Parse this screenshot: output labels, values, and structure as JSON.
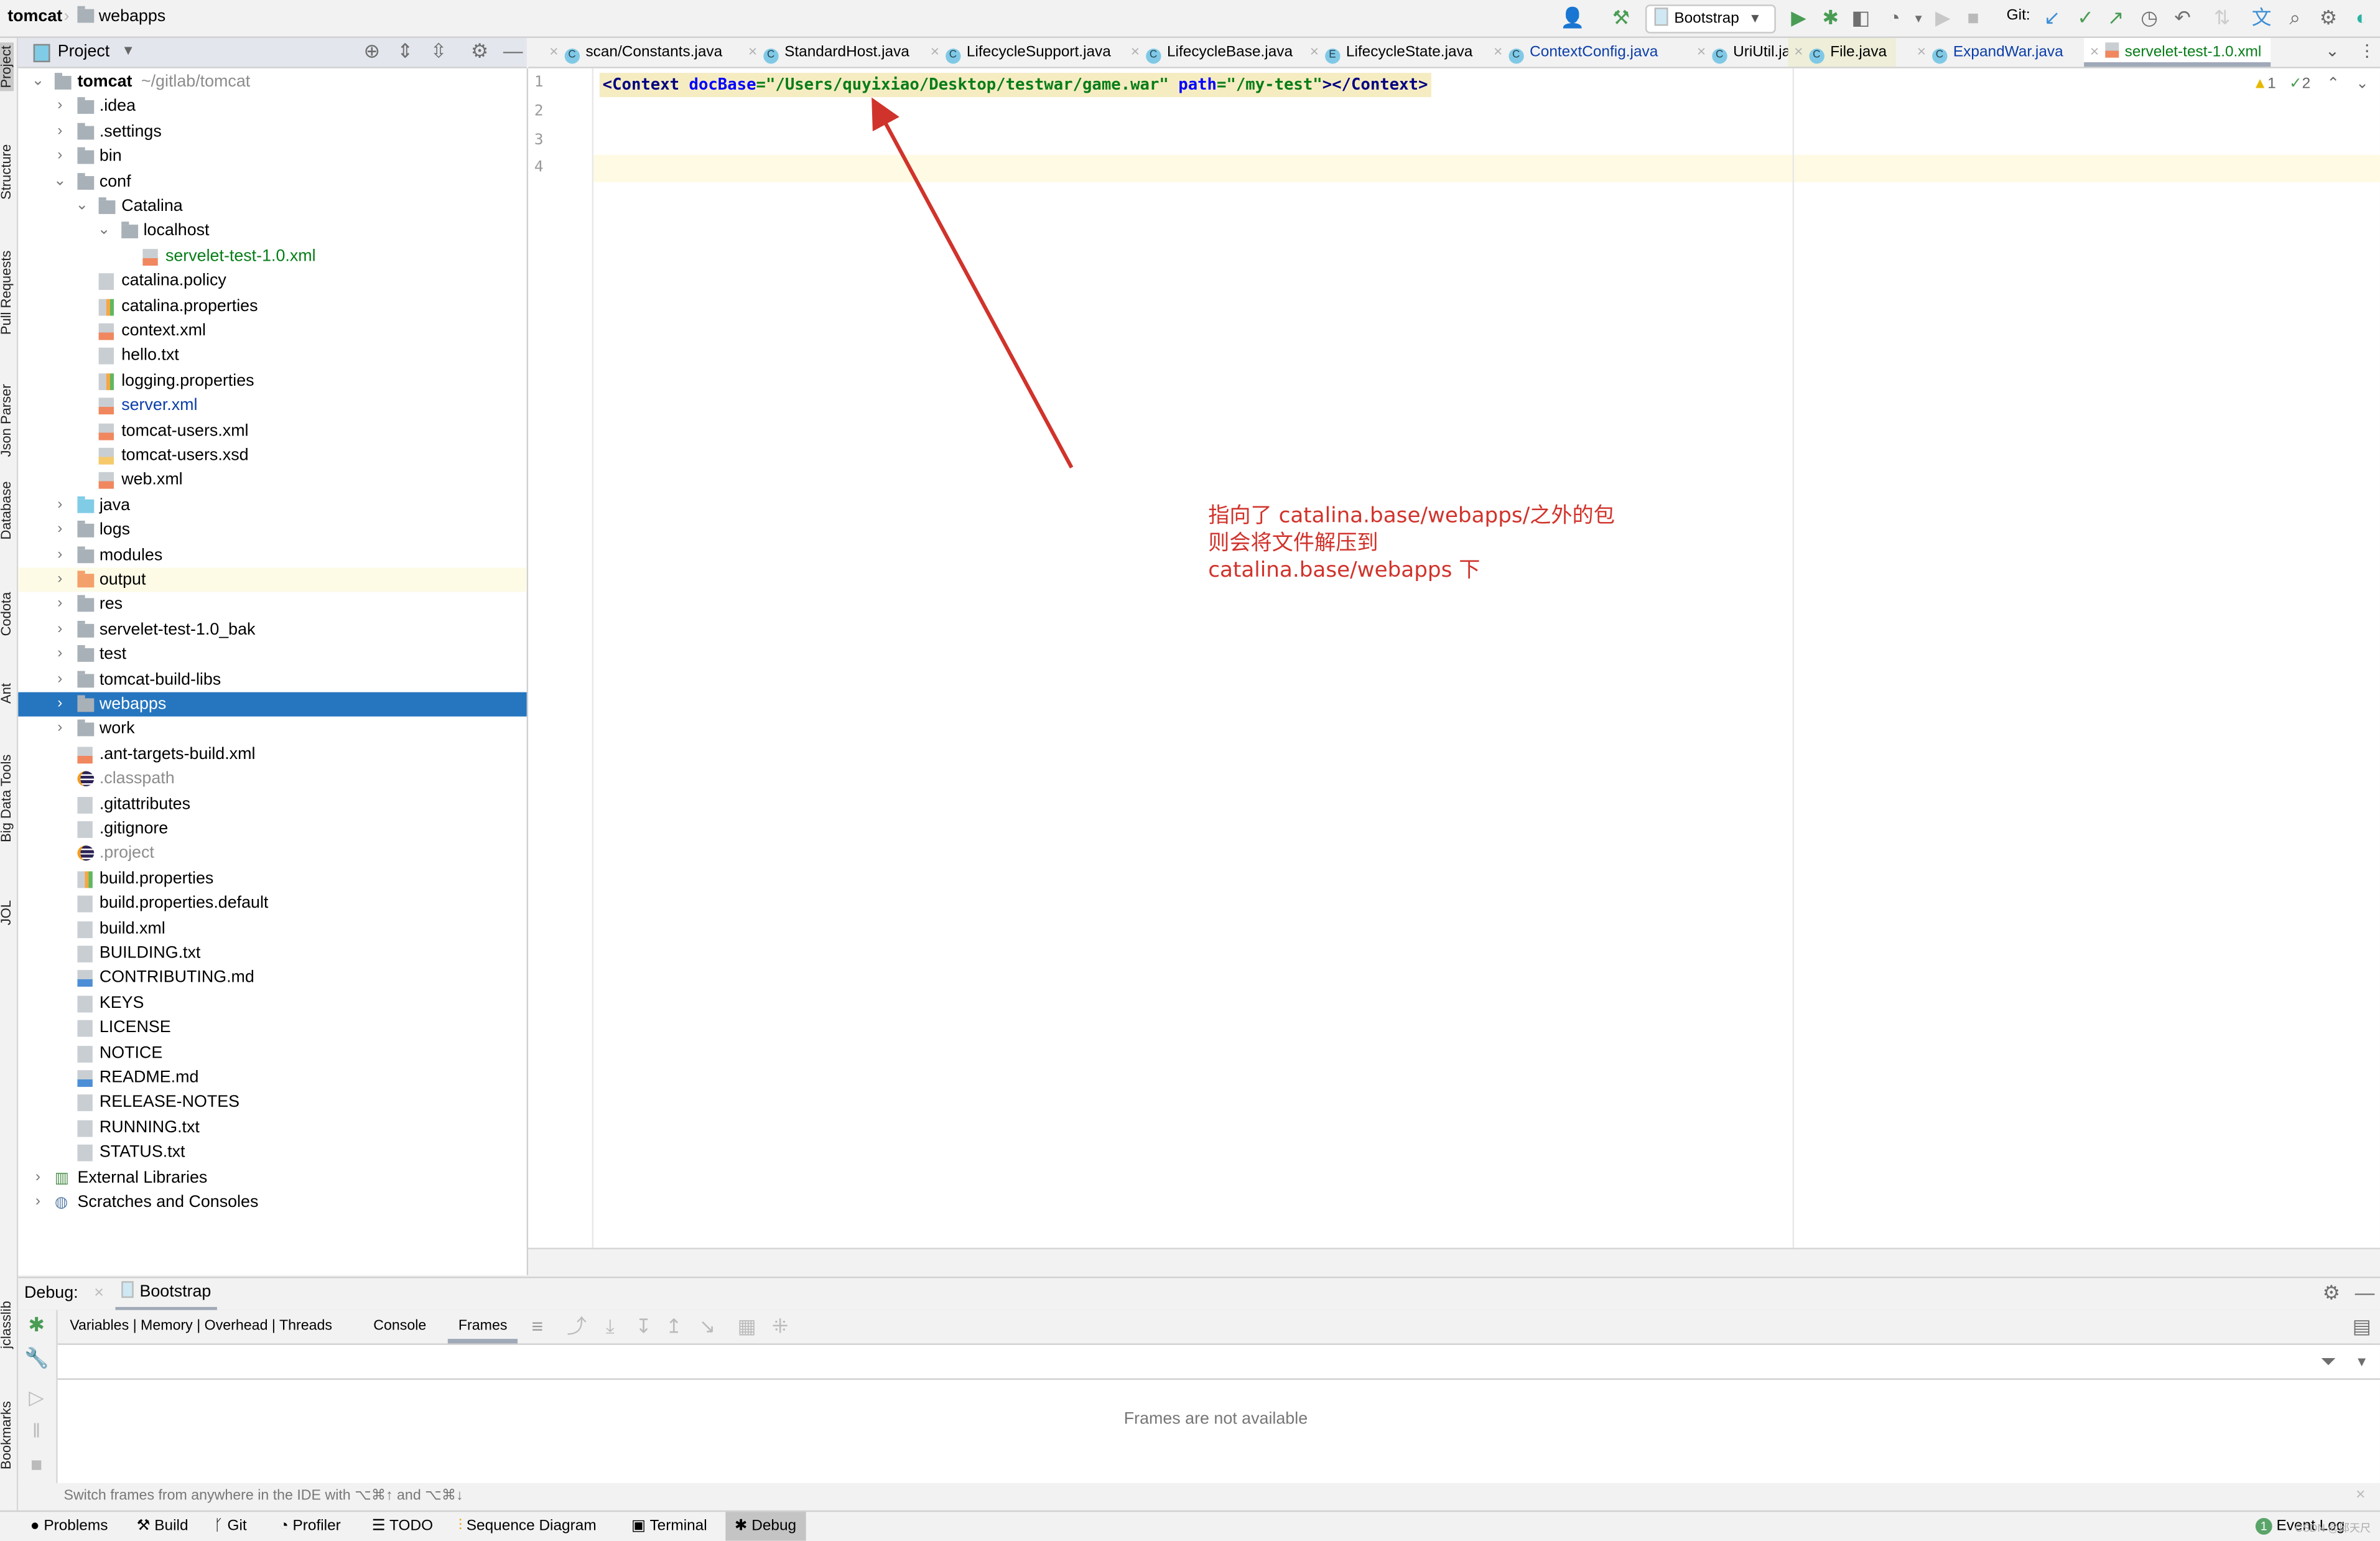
{
  "navbar": {
    "project": "tomcat",
    "folder": "webapps",
    "run_config": "Bootstrap",
    "git_label": "Git:",
    "icons": [
      "user-icon",
      "build-hammer-icon",
      "run-icon",
      "debug-icon",
      "coverage-icon",
      "profile-icon",
      "resume-icon",
      "stop-icon",
      "git-update-icon",
      "git-commit-icon",
      "git-push-icon",
      "history-icon",
      "rollback-icon",
      "translate-icon",
      "search-icon",
      "settings-icon",
      "jetbrains-logo"
    ]
  },
  "left_stripe": [
    "Project",
    "Structure",
    "Pull Requests",
    "Json Parser",
    "Database",
    "Codota",
    "Ant",
    "Big Data Tools",
    "JOL",
    "jclasslib",
    "Bookmarks"
  ],
  "project_panel": {
    "title": "Project",
    "tree": [
      {
        "label": "tomcat",
        "suffix": "~/gitlab/tomcat",
        "depth": 0,
        "kind": "module",
        "expanded": true,
        "bold": true
      },
      {
        "label": ".idea",
        "depth": 1,
        "kind": "folder",
        "collapsed": true
      },
      {
        "label": ".settings",
        "depth": 1,
        "kind": "folder",
        "collapsed": true
      },
      {
        "label": "bin",
        "depth": 1,
        "kind": "folder",
        "collapsed": true
      },
      {
        "label": "conf",
        "depth": 1,
        "kind": "folder",
        "expanded": true
      },
      {
        "label": "Catalina",
        "depth": 2,
        "kind": "folder",
        "expanded": true
      },
      {
        "label": "localhost",
        "depth": 3,
        "kind": "folder",
        "expanded": true
      },
      {
        "label": "servelet-test-1.0.xml",
        "depth": 4,
        "kind": "xml",
        "color": "#067d17"
      },
      {
        "label": "catalina.policy",
        "depth": 2,
        "kind": "doc"
      },
      {
        "label": "catalina.properties",
        "depth": 2,
        "kind": "prop"
      },
      {
        "label": "context.xml",
        "depth": 2,
        "kind": "xml"
      },
      {
        "label": "hello.txt",
        "depth": 2,
        "kind": "doc"
      },
      {
        "label": "logging.properties",
        "depth": 2,
        "kind": "prop"
      },
      {
        "label": "server.xml",
        "depth": 2,
        "kind": "xml",
        "color": "#0b3ea8"
      },
      {
        "label": "tomcat-users.xml",
        "depth": 2,
        "kind": "xml"
      },
      {
        "label": "tomcat-users.xsd",
        "depth": 2,
        "kind": "xsd"
      },
      {
        "label": "web.xml",
        "depth": 2,
        "kind": "xml"
      },
      {
        "label": "java",
        "depth": 1,
        "kind": "folder-blue",
        "collapsed": true
      },
      {
        "label": "logs",
        "depth": 1,
        "kind": "folder",
        "collapsed": true
      },
      {
        "label": "modules",
        "depth": 1,
        "kind": "folder",
        "collapsed": true
      },
      {
        "label": "output",
        "depth": 1,
        "kind": "folder-orange",
        "collapsed": true,
        "highlight": true
      },
      {
        "label": "res",
        "depth": 1,
        "kind": "folder",
        "collapsed": true
      },
      {
        "label": "servelet-test-1.0_bak",
        "depth": 1,
        "kind": "folder",
        "collapsed": true
      },
      {
        "label": "test",
        "depth": 1,
        "kind": "folder",
        "collapsed": true
      },
      {
        "label": "tomcat-build-libs",
        "depth": 1,
        "kind": "folder",
        "collapsed": true
      },
      {
        "label": "webapps",
        "depth": 1,
        "kind": "folder",
        "collapsed": true,
        "selected": true
      },
      {
        "label": "work",
        "depth": 1,
        "kind": "folder",
        "collapsed": true
      },
      {
        "label": ".ant-targets-build.xml",
        "depth": 1,
        "kind": "xml"
      },
      {
        "label": ".classpath",
        "depth": 1,
        "kind": "eclipse",
        "color": "#8c8c8c"
      },
      {
        "label": ".gitattributes",
        "depth": 1,
        "kind": "doc"
      },
      {
        "label": ".gitignore",
        "depth": 1,
        "kind": "doc"
      },
      {
        "label": ".project",
        "depth": 1,
        "kind": "eclipse",
        "color": "#8c8c8c"
      },
      {
        "label": "build.properties",
        "depth": 1,
        "kind": "prop"
      },
      {
        "label": "build.properties.default",
        "depth": 1,
        "kind": "doc"
      },
      {
        "label": "build.xml",
        "depth": 1,
        "kind": "doc"
      },
      {
        "label": "BUILDING.txt",
        "depth": 1,
        "kind": "doc"
      },
      {
        "label": "CONTRIBUTING.md",
        "depth": 1,
        "kind": "md"
      },
      {
        "label": "KEYS",
        "depth": 1,
        "kind": "doc"
      },
      {
        "label": "LICENSE",
        "depth": 1,
        "kind": "doc"
      },
      {
        "label": "NOTICE",
        "depth": 1,
        "kind": "doc"
      },
      {
        "label": "README.md",
        "depth": 1,
        "kind": "md"
      },
      {
        "label": "RELEASE-NOTES",
        "depth": 1,
        "kind": "doc"
      },
      {
        "label": "RUNNING.txt",
        "depth": 1,
        "kind": "doc"
      },
      {
        "label": "STATUS.txt",
        "depth": 1,
        "kind": "doc"
      },
      {
        "label": "External Libraries",
        "depth": 0,
        "kind": "libs",
        "collapsed": true
      },
      {
        "label": "Scratches and Consoles",
        "depth": 0,
        "kind": "scratch",
        "collapsed": true
      }
    ]
  },
  "editor": {
    "tabs": [
      {
        "label": "scan/Constants.java",
        "icon": "C",
        "color": "#000"
      },
      {
        "label": "StandardHost.java",
        "icon": "C",
        "color": "#000"
      },
      {
        "label": "LifecycleSupport.java",
        "icon": "C",
        "color": "#000"
      },
      {
        "label": "LifecycleBase.java",
        "icon": "C",
        "color": "#000"
      },
      {
        "label": "LifecycleState.java",
        "icon": "E",
        "color": "#000"
      },
      {
        "label": "ContextConfig.java",
        "icon": "C",
        "color": "#0b3ea8"
      },
      {
        "label": "UriUtil.java",
        "icon": "C",
        "color": "#000"
      },
      {
        "label": "File.java",
        "icon": "C",
        "color": "#000",
        "tint": true
      },
      {
        "label": "ExpandWar.java",
        "icon": "C",
        "color": "#0b3ea8"
      },
      {
        "label": "servelet-test-1.0.xml",
        "icon": "xml",
        "color": "#067d17",
        "active": true
      }
    ],
    "line_numbers": [
      "1",
      "2",
      "3",
      "4"
    ],
    "code": {
      "open_tag": "<Context",
      "attr1": "docBase",
      "eq1": "=",
      "val1": "\"/Users/quyixiao/Desktop/testwar/game.war\"",
      "attr2": "path",
      "eq2": "=",
      "val2": "\"/my-test\"",
      "close": "></Context>"
    },
    "inspections": {
      "warnings": "1",
      "typos": "2"
    },
    "annotation": {
      "line1": "指向了 catalina.base/webapps/之外的包",
      "line2": "则会将文件解压到",
      "line3": "catalina.base/webapps 下",
      "color": "#d0332b"
    }
  },
  "debug": {
    "label": "Debug:",
    "session": "Bootstrap",
    "tabs": [
      {
        "label": "Variables | Memory | Overhead | Threads"
      },
      {
        "label": "Console"
      },
      {
        "label": "Frames",
        "active": true
      }
    ],
    "empty_text": "Frames are not available",
    "hint": "Switch frames from anywhere in the IDE with ⌥⌘↑ and ⌥⌘↓"
  },
  "statusbar": {
    "items": [
      "Problems",
      "Build",
      "Git",
      "Profiler",
      "TODO",
      "Sequence Diagram",
      "Terminal",
      "Debug"
    ],
    "active": "Debug",
    "event_log": "Event Log",
    "event_count": "1"
  },
  "watermark": "CSDN @邱天尺"
}
